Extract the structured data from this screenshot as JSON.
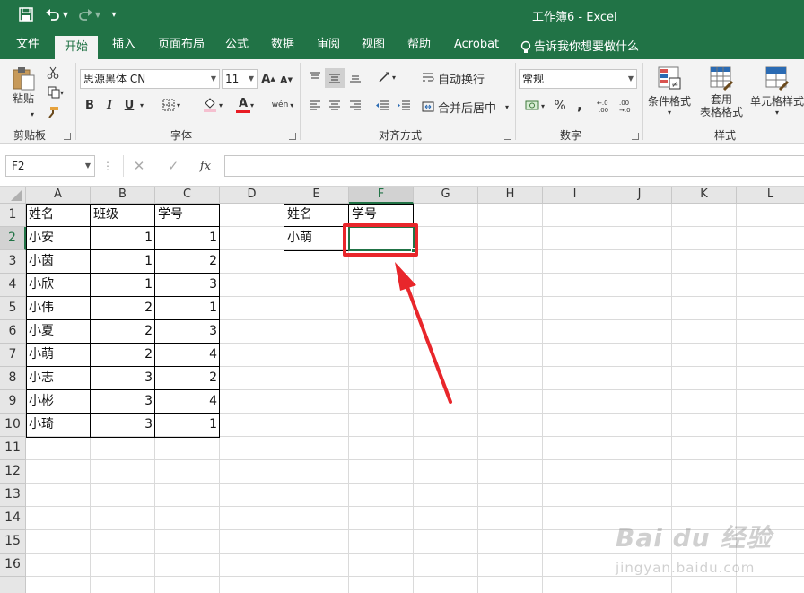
{
  "window": {
    "title": "工作簿6  -   Excel"
  },
  "tabs": [
    "文件",
    "开始",
    "插入",
    "页面布局",
    "公式",
    "数据",
    "审阅",
    "视图",
    "帮助",
    "Acrobat"
  ],
  "active_tab": "开始",
  "tell_me": "告诉我你想要做什么",
  "ribbon": {
    "paste_label": "粘贴",
    "font_name": "思源黑体 CN",
    "font_size": "11",
    "wrap_text": "自动换行",
    "merge_center": "合并后居中",
    "number_format": "常规",
    "cond_format": "条件格式",
    "table_format_1": "套用",
    "table_format_2": "表格格式",
    "cell_style": "单元格样式",
    "bold": "B",
    "italic": "I",
    "underline": "U",
    "font_color_letter": "A",
    "percent": "%",
    "comma": ",",
    "fx": "fx",
    "wen": "wén",
    "groups": {
      "clipboard": "剪贴板",
      "font": "字体",
      "alignment": "对齐方式",
      "number": "数字",
      "styles": "样式"
    }
  },
  "namebox": "F2",
  "columns": [
    "A",
    "B",
    "C",
    "D",
    "E",
    "F",
    "G",
    "H",
    "I",
    "J",
    "K",
    "L"
  ],
  "rows": [
    "1",
    "2",
    "3",
    "4",
    "5",
    "6",
    "7",
    "8",
    "9",
    "10",
    "11",
    "12",
    "13",
    "14",
    "15",
    "16"
  ],
  "table1": {
    "header": [
      "姓名",
      "班级",
      "学号"
    ],
    "rows": [
      [
        "小安",
        "1",
        "1"
      ],
      [
        "小茵",
        "1",
        "2"
      ],
      [
        "小欣",
        "1",
        "3"
      ],
      [
        "小伟",
        "2",
        "1"
      ],
      [
        "小夏",
        "2",
        "3"
      ],
      [
        "小萌",
        "2",
        "4"
      ],
      [
        "小志",
        "3",
        "2"
      ],
      [
        "小彬",
        "3",
        "4"
      ],
      [
        "小琦",
        "3",
        "1"
      ]
    ]
  },
  "table2": {
    "header": [
      "姓名",
      "学号"
    ],
    "rows": [
      [
        "小萌",
        ""
      ]
    ]
  },
  "watermark": {
    "brand": "Bai du 经验",
    "url": "jingyan.baidu.com"
  },
  "colors": {
    "excel_green": "#217346",
    "highlight_red": "#e8262b",
    "font_color_bar": "#e81b23"
  }
}
